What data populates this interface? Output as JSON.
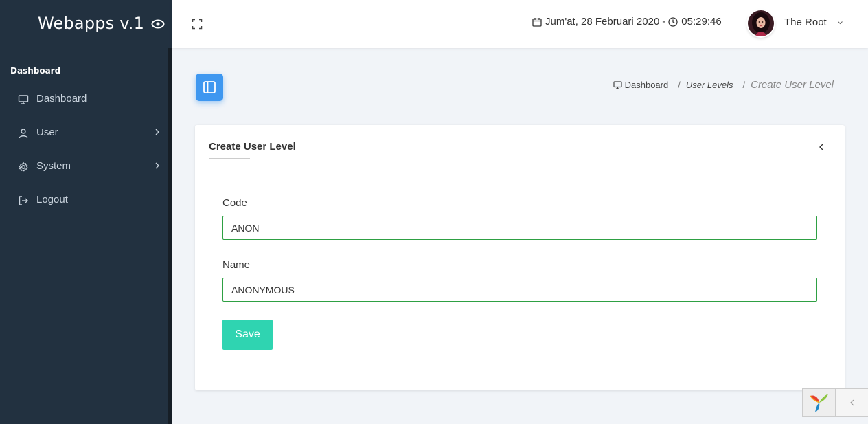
{
  "brand": {
    "title": "Webapps v.1"
  },
  "sidebar": {
    "heading": "Dashboard",
    "items": [
      {
        "label": "Dashboard",
        "icon": "monitor-icon"
      },
      {
        "label": "User",
        "icon": "user-icon"
      },
      {
        "label": "System",
        "icon": "gear-icon"
      },
      {
        "label": "Logout",
        "icon": "logout-icon"
      }
    ]
  },
  "topbar": {
    "date": "Jum'at, 28 Februari 2020",
    "separator": "-",
    "time": "05:29:46",
    "username": "The Root"
  },
  "breadcrumb": {
    "home": "Dashboard",
    "parent": "User Levels",
    "current": "Create User Level"
  },
  "form": {
    "title": "Create User Level",
    "code_label": "Code",
    "code_value": "ANON",
    "name_label": "Name",
    "name_value": "ANONYMOUS",
    "save_label": "Save"
  },
  "colors": {
    "sidebar_bg": "#223140",
    "accent_blue": "#3e97f0",
    "save_button": "#2fd4b1",
    "input_border": "#2ea043",
    "page_bg": "#f1f4f8"
  }
}
